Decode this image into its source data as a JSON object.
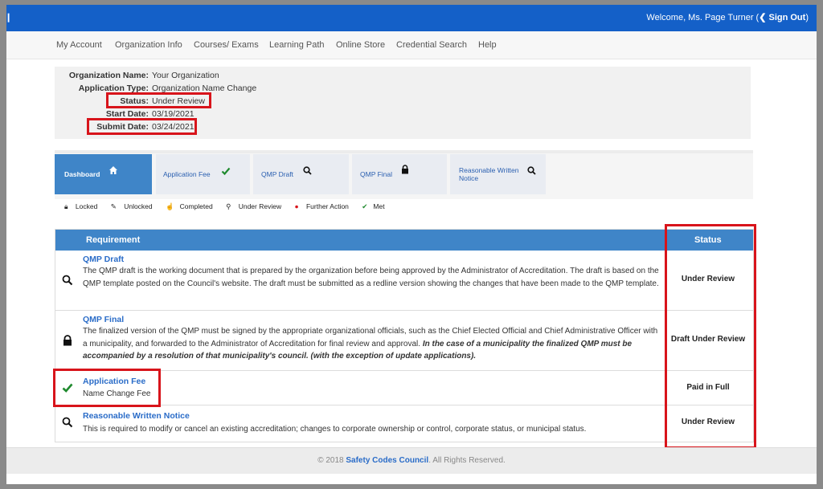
{
  "topbar": {
    "welcome_prefix": "Welcome, Ms. Page Turner (",
    "signout_label": "❮ Sign Out",
    "welcome_suffix": ")"
  },
  "nav": {
    "items": [
      "My Account",
      "Organization Info",
      "Courses/ Exams",
      "Learning Path",
      "Online Store",
      "Credential Search",
      "Help"
    ]
  },
  "info": {
    "rows": [
      {
        "label": "Organization Name:",
        "value": "Your Organization"
      },
      {
        "label": "Application Type:",
        "value": "Organization Name Change"
      },
      {
        "label": "Status:",
        "value": "Under Review"
      },
      {
        "label": "Start Date:",
        "value": "03/19/2021"
      },
      {
        "label": "Submit Date:",
        "value": "03/24/2021"
      }
    ]
  },
  "tabs": [
    {
      "label": "Dashboard",
      "icon": "home-icon"
    },
    {
      "label": "Application Fee",
      "icon": "check-icon"
    },
    {
      "label": "QMP Draft",
      "icon": "search-icon"
    },
    {
      "label": "QMP Final",
      "icon": "lock-icon"
    },
    {
      "label_line1": "Reasonable Written",
      "label_line2": "Notice",
      "icon": "search-icon"
    }
  ],
  "legend": {
    "locked": "Locked",
    "unlocked": "Unlocked",
    "completed": "Completed",
    "under_review": "Under Review",
    "further_action": "Further Action",
    "met": "Met"
  },
  "table": {
    "header_requirement": "Requirement",
    "header_status": "Status",
    "rows": [
      {
        "title": "QMP Draft",
        "desc": "The QMP draft is the working document that is prepared by the organization before being approved by the Administrator of Accreditation. The draft is based on the QMP template posted on the Council's website. The draft must be submitted as a redline version showing the changes that have been made to the QMP template.",
        "status": "Under Review",
        "icon": "search-icon"
      },
      {
        "title": "QMP Final",
        "desc": "The finalized version of the QMP must be signed by the appropriate organizational officials, such as the Chief Elected Official and Chief Administrative Officer with a municipality, and forwarded to the Administrator of Accreditation for final review and approval.",
        "desc_emphasis": "In the case of a municipality the finalized QMP must be accompanied by a resolution of that municipality's council. (with the exception of update applications).",
        "status": "Draft Under Review",
        "icon": "lock-icon"
      },
      {
        "title": "Application Fee",
        "desc": "Name Change Fee",
        "status": "Paid in Full",
        "icon": "check-icon"
      },
      {
        "title": "Reasonable Written Notice",
        "desc": "This is required to modify or cancel an existing accreditation; changes to corporate ownership or control, corporate status, or municipal status.",
        "status": "Under Review",
        "icon": "search-icon"
      }
    ]
  },
  "footer": {
    "prefix": "© 2018",
    "brand": "Safety Codes Council",
    "suffix": ". All Rights Reserved."
  },
  "colors": {
    "topbar": "#1460c8",
    "accent_blue": "#3f85c8",
    "link_blue": "#2a6cc8",
    "highlight_red": "#d8141b",
    "met_green": "#1f8a2e"
  }
}
